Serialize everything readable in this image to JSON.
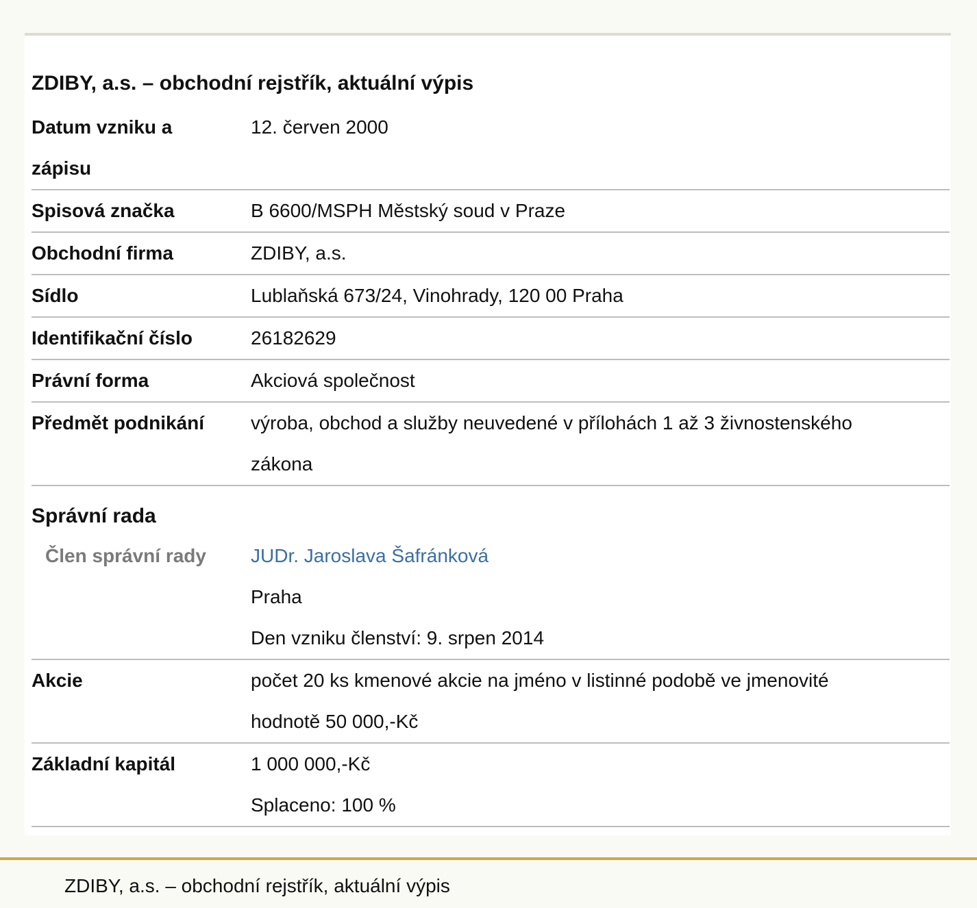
{
  "title": "ZDIBY, a.s. – obchodní rejstřík, aktuální výpis",
  "rows": {
    "datum": {
      "label_line1": "Datum vzniku a",
      "label_line2": "zápisu",
      "value": "12. červen 2000"
    },
    "spisova": {
      "label": "Spisová značka",
      "value": "B 6600/MSPH Městský soud v Praze"
    },
    "firma": {
      "label": "Obchodní firma",
      "value": "ZDIBY, a.s."
    },
    "sidlo": {
      "label": "Sídlo",
      "value": "Lublaňská 673/24, Vinohrady, 120 00 Praha"
    },
    "ico": {
      "label": "Identifikační číslo",
      "value": "26182629"
    },
    "forma": {
      "label": "Právní forma",
      "value": "Akciová společnost"
    },
    "predmet": {
      "label": "Předmět podnikání",
      "value_line1": "výroba, obchod a služby neuvedené v přílohách 1 až 3 živnostenského",
      "value_line2": "zákona"
    }
  },
  "board": {
    "section_title": "Správní rada",
    "member_label": "Člen správní rady",
    "member_name": "JUDr. Jaroslava Šafránková",
    "member_city": "Praha",
    "member_since": "Den vzniku členství: 9. srpen 2014"
  },
  "rows2": {
    "akcie": {
      "label": "Akcie",
      "value_line1": "počet 20 ks kmenové akcie na jméno v listinné podobě ve jmenovité",
      "value_line2": "hodnotě 50 000,-Kč"
    },
    "kapital": {
      "label": "Základní kapitál",
      "value_line1": "1 000 000,-Kč",
      "value_line2": "Splaceno: 100 %"
    }
  },
  "footer": {
    "text": "ZDIBY, a.s. – obchodní rejstřík, aktuální výpis"
  },
  "colors": {
    "link": "#3a6ea5",
    "footer_border": "#cfa93f",
    "sublabel": "#7a7a7a"
  }
}
